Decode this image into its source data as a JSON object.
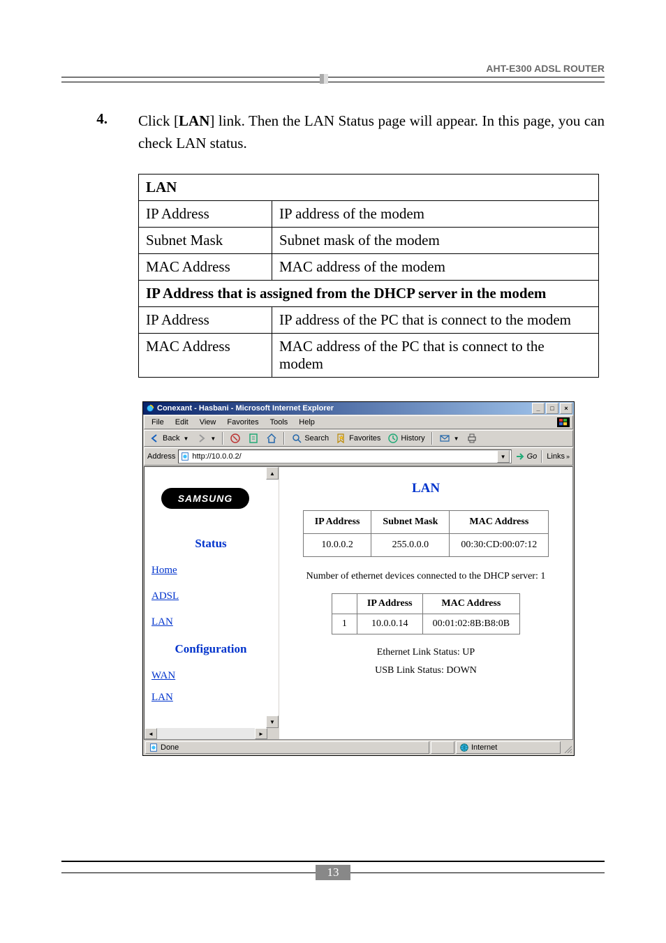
{
  "header": {
    "product": "AHT-E300 ADSL ROUTER"
  },
  "step": {
    "number": "4.",
    "text_prefix": "Click [",
    "link_word": "LAN",
    "text_suffix": "] link. Then the LAN Status page will appear. In this page, you can check LAN status."
  },
  "desc_table": {
    "section1": "LAN",
    "rows1": [
      {
        "label": "IP Address",
        "value": "IP address of the modem"
      },
      {
        "label": "Subnet Mask",
        "value": "Subnet mask of the modem"
      },
      {
        "label": "MAC Address",
        "value": "MAC address of the modem"
      }
    ],
    "section2": "IP Address that is assigned from the DHCP server in the modem",
    "rows2": [
      {
        "label": "IP Address",
        "value": "IP address of the PC that is connect to the modem"
      },
      {
        "label": "MAC Address",
        "value": "MAC address of the PC that is connect to the modem"
      }
    ]
  },
  "browser": {
    "title": "Conexant - Hasbani - Microsoft Internet Explorer",
    "menus": [
      "File",
      "Edit",
      "View",
      "Favorites",
      "Tools",
      "Help"
    ],
    "toolbar": {
      "back": "Back",
      "search": "Search",
      "favorites": "Favorites",
      "history": "History"
    },
    "address_label": "Address",
    "address_value": "http://10.0.0.2/",
    "go": "Go",
    "links": "Links",
    "status_done": "Done",
    "status_zone": "Internet"
  },
  "samsung": "SAMSUNG",
  "sidebar": {
    "status_heading": "Status",
    "links_status": [
      "Home",
      "ADSL",
      "LAN"
    ],
    "config_heading": "Configuration",
    "links_config": [
      "WAN",
      "LAN"
    ]
  },
  "main": {
    "title": "LAN",
    "lan_headers": [
      "IP Address",
      "Subnet Mask",
      "MAC Address"
    ],
    "lan_row": [
      "10.0.0.2",
      "255.0.0.0",
      "00:30:CD:00:07:12"
    ],
    "dhcp_text": "Number of ethernet devices connected to the DHCP server: 1",
    "dhcp_headers": [
      "",
      "IP Address",
      "MAC Address"
    ],
    "dhcp_row": [
      "1",
      "10.0.0.14",
      "00:01:02:8B:B8:0B"
    ],
    "eth_status": "Ethernet Link Status: UP",
    "usb_status": "USB Link Status: DOWN"
  },
  "footer_page": "13"
}
